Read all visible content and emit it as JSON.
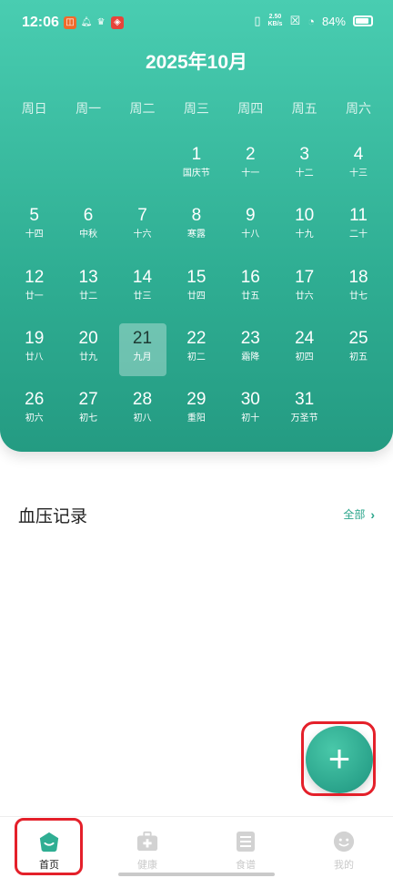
{
  "status_bar": {
    "time": "12:06",
    "net_speed_value": "2.50",
    "net_speed_unit": "KB/s",
    "battery": "84%"
  },
  "calendar": {
    "title": "2025年10月",
    "weekdays": [
      "周日",
      "周一",
      "周二",
      "周三",
      "周四",
      "周五",
      "周六"
    ],
    "leading_blanks": 3,
    "selected_day": "21",
    "days": [
      {
        "num": "1",
        "sub": "国庆节"
      },
      {
        "num": "2",
        "sub": "十一"
      },
      {
        "num": "3",
        "sub": "十二"
      },
      {
        "num": "4",
        "sub": "十三"
      },
      {
        "num": "5",
        "sub": "十四"
      },
      {
        "num": "6",
        "sub": "中秋"
      },
      {
        "num": "7",
        "sub": "十六"
      },
      {
        "num": "8",
        "sub": "寒露"
      },
      {
        "num": "9",
        "sub": "十八"
      },
      {
        "num": "10",
        "sub": "十九"
      },
      {
        "num": "11",
        "sub": "二十"
      },
      {
        "num": "12",
        "sub": "廿一"
      },
      {
        "num": "13",
        "sub": "廿二"
      },
      {
        "num": "14",
        "sub": "廿三"
      },
      {
        "num": "15",
        "sub": "廿四"
      },
      {
        "num": "16",
        "sub": "廿五"
      },
      {
        "num": "17",
        "sub": "廿六"
      },
      {
        "num": "18",
        "sub": "廿七"
      },
      {
        "num": "19",
        "sub": "廿八"
      },
      {
        "num": "20",
        "sub": "廿九"
      },
      {
        "num": "21",
        "sub": "九月"
      },
      {
        "num": "22",
        "sub": "初二"
      },
      {
        "num": "23",
        "sub": "霜降"
      },
      {
        "num": "24",
        "sub": "初四"
      },
      {
        "num": "25",
        "sub": "初五"
      },
      {
        "num": "26",
        "sub": "初六"
      },
      {
        "num": "27",
        "sub": "初七"
      },
      {
        "num": "28",
        "sub": "初八"
      },
      {
        "num": "29",
        "sub": "重阳"
      },
      {
        "num": "30",
        "sub": "初十"
      },
      {
        "num": "31",
        "sub": "万圣节"
      }
    ]
  },
  "records": {
    "title": "血压记录",
    "see_all": "全部"
  },
  "nav": {
    "home": "首页",
    "health": "健康",
    "recipes": "食谱",
    "mine": "我的"
  },
  "colors": {
    "primary": "#2fae93",
    "highlight": "#e4202a"
  }
}
